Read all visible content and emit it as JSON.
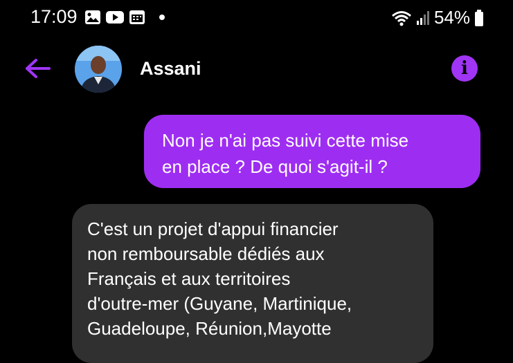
{
  "status_bar": {
    "time": "17:09",
    "battery": "54%",
    "icons": [
      "gallery-icon",
      "youtube-icon",
      "calendar-icon",
      "notification-dot",
      "wifi-icon",
      "signal-icon",
      "battery-icon"
    ]
  },
  "conversation": {
    "contact_name": "Assani",
    "back_icon": "arrow-left-icon",
    "info_icon": "info-icon",
    "accent_color": "#a035f5"
  },
  "messages": [
    {
      "direction": "outgoing",
      "lines": [
        "Non je n'ai pas suivi cette mise",
        "en place ? De quoi s'agit-il ?"
      ]
    },
    {
      "direction": "incoming",
      "lines": [
        "C'est un projet d'appui financier",
        "non remboursable dédiés aux",
        "Français et aux territoires",
        "d'outre-mer (Guyane, Martinique,",
        "Guadeloupe, Réunion,Mayotte"
      ]
    }
  ]
}
